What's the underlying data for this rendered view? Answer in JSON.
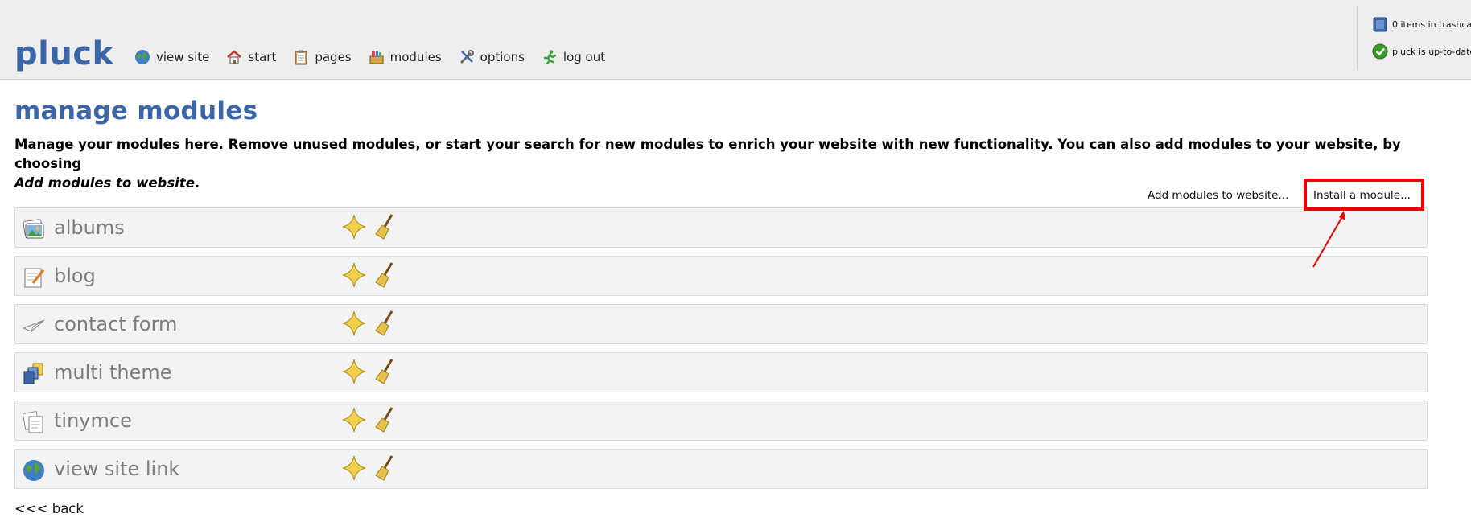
{
  "app": {
    "logo": "pluck"
  },
  "nav": [
    {
      "label": "view site",
      "icon": "globe-icon"
    },
    {
      "label": "start",
      "icon": "home-icon"
    },
    {
      "label": "pages",
      "icon": "clipboard-icon"
    },
    {
      "label": "modules",
      "icon": "modules-icon"
    },
    {
      "label": "options",
      "icon": "tools-icon"
    },
    {
      "label": "log out",
      "icon": "running-man-icon"
    }
  ],
  "status": {
    "trash": "0 items in trashca",
    "update": "pluck is up-to-date"
  },
  "page": {
    "title": "manage modules",
    "intro": "Manage your modules here. Remove unused modules, or start your search for new modules to enrich your website with new functionality. You can also add modules to your website, by choosing",
    "intro_em": "Add modules to website",
    "intro_end": "."
  },
  "actions": {
    "add": "Add modules to website...",
    "install": "Install a module..."
  },
  "modules": [
    {
      "name": "albums",
      "icon": "albums-icon"
    },
    {
      "name": "blog",
      "icon": "blog-icon"
    },
    {
      "name": "contact form",
      "icon": "paper-plane-icon"
    },
    {
      "name": "multi theme",
      "icon": "multi-theme-icon"
    },
    {
      "name": "tinymce",
      "icon": "tinymce-icon"
    },
    {
      "name": "view site link",
      "icon": "globe-icon"
    }
  ],
  "back": "<<< back",
  "colors": {
    "accent": "#3a65a6",
    "highlight": "#ee0000",
    "header_bg": "#eeeeee"
  }
}
